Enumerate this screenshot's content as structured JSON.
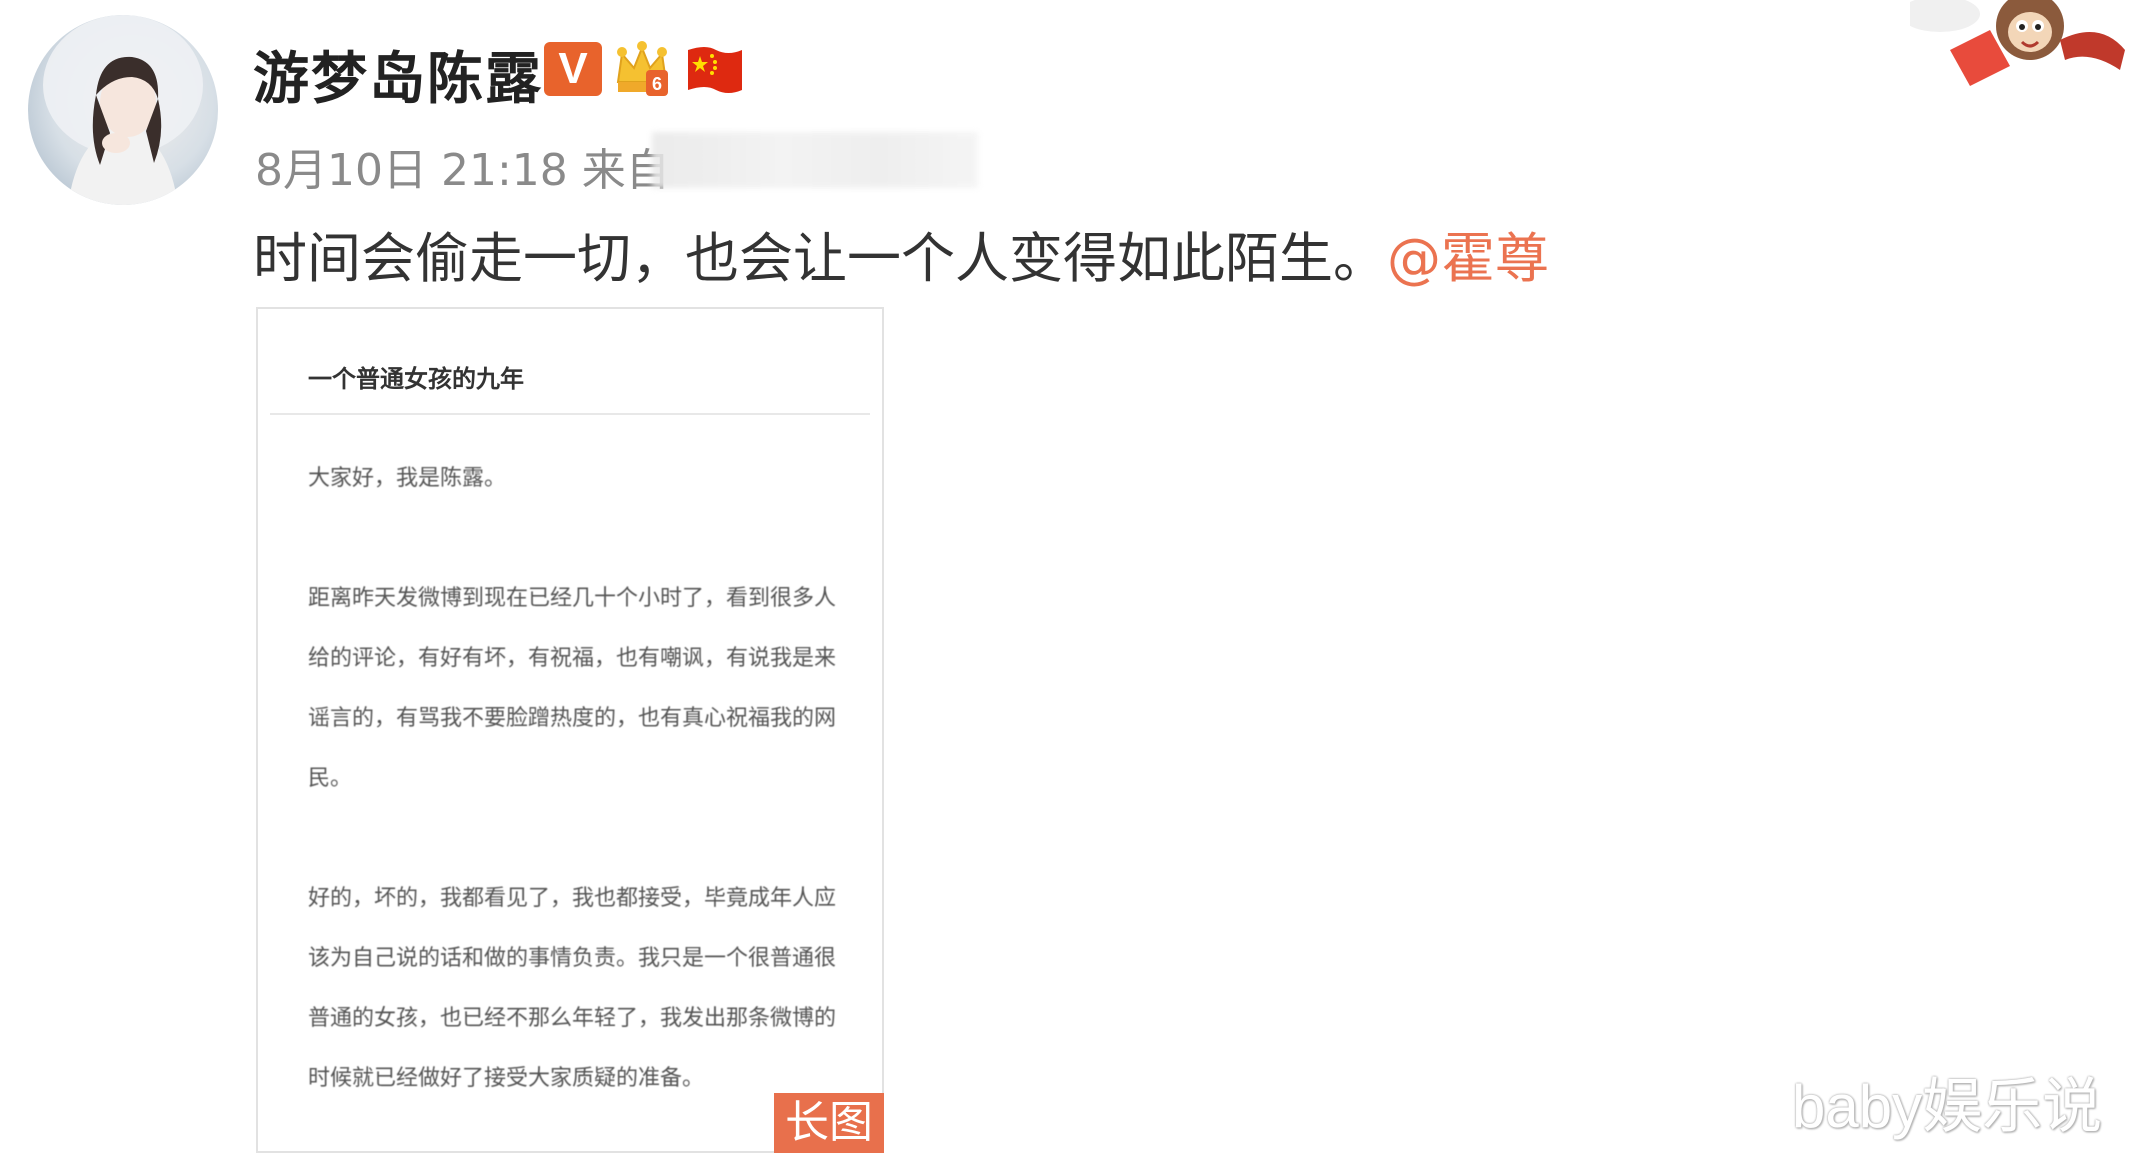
{
  "post": {
    "username": "游梦岛陈露",
    "verified_badge": "V",
    "timestamp": "8月10日 21:18",
    "source_prefix": "来自",
    "text": "时间会偷走一切，也会让一个人变得如此陌生。",
    "mention": "@霍尊"
  },
  "card": {
    "title": "一个普通女孩的九年",
    "paragraphs": [
      "大家好，我是陈露。",
      "距离昨天发微博到现在已经几十个小时了，看到很多人给的评论，有好有坏，有祝福，也有嘲讽，有说我是来谣言的，有骂我不要脸蹭热度的，也有真心祝福我的网民。",
      "好的，坏的，我都看见了，我也都接受，毕竟成年人应该为自己说的话和做的事情负责。我只是一个很普通很普通的女孩，也已经不那么年轻了，我发出那条微博的时候就已经做好了接受大家质疑的准备。"
    ],
    "long_image_tag": "长图"
  },
  "watermark": "baby娱乐说",
  "colors": {
    "mention": "#eb7350",
    "verified": "#e8632c",
    "long_tag": "#e8704c"
  },
  "icons": [
    "avatar",
    "verified-v-icon",
    "crown-level-icon",
    "china-flag-icon",
    "sticker-decoration"
  ]
}
